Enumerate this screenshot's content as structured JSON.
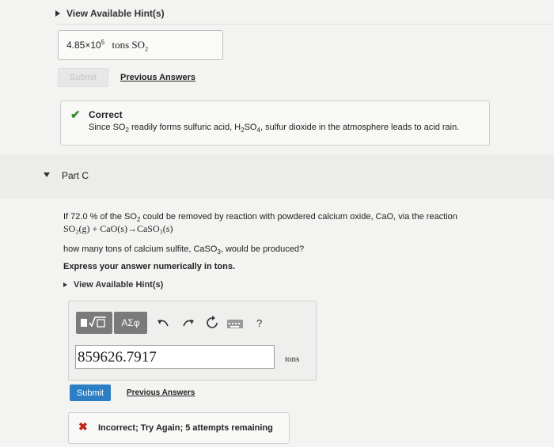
{
  "partB": {
    "hint_label": "View Available Hint(s)",
    "answer_value": "4.85×10",
    "answer_exp": "5",
    "answer_unit": "tons SO",
    "answer_unit_sub": "2",
    "submit_label": "Submit",
    "previous_answers": "Previous Answers",
    "correct_title": "Correct",
    "correct_text_1": "Since SO",
    "correct_sub_1": "2",
    "correct_text_2": " readily forms sulfuric acid, H",
    "correct_sub_2": "2",
    "correct_text_3": "SO",
    "correct_sub_3": "4",
    "correct_text_4": ", sulfur dioxide in the atmosphere leads to acid rain."
  },
  "partC": {
    "title": "Part C",
    "q1_a": "If 72.0 % of the SO",
    "q1_sub": "2",
    "q1_b": " could be removed by reaction with powdered calcium oxide, CaO, via the reaction",
    "reaction": "SO₂(g) + CaO(s)→CaSO₃(s)",
    "q2_a": "how many tons of calcium sulfite, CaSO",
    "q2_sub": "3",
    "q2_b": ", would be produced?",
    "instruction": "Express your answer numerically in tons.",
    "hint_label": "View Available Hint(s)",
    "toolbar_greek": "ΑΣφ",
    "toolbar_help": "?",
    "input_value": "859626.7917",
    "unit": "tons",
    "submit_label": "Submit",
    "previous_answers": "Previous Answers",
    "feedback": "Incorrect; Try Again; 5 attempts remaining"
  },
  "colors": {
    "correct_green": "#3a8a2a",
    "incorrect_red": "#c0271e",
    "submit_blue": "#2c7fc4"
  }
}
